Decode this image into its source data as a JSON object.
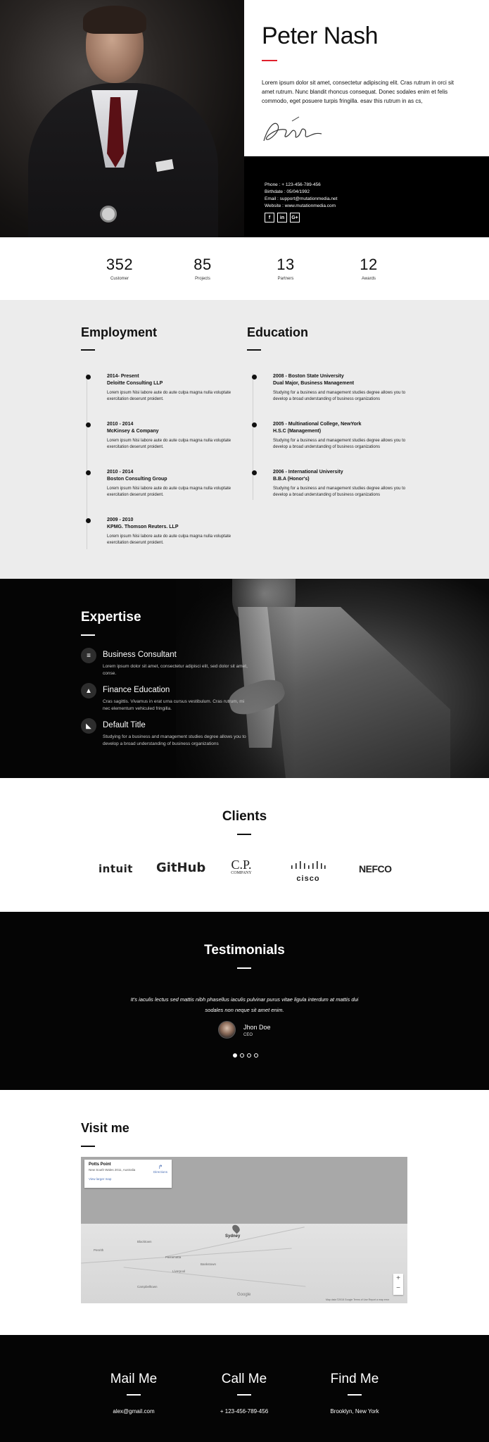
{
  "hero": {
    "name": "Peter Nash",
    "bio": "Lorem ipsum dolor sit amet, consectetur adipiscing elit. Cras rutrum in orci sit amet rutrum. Nunc blandit rhoncus consequat. Donec sodales enim et felis commodo, eget posuere turpis fringilla. esav this rutrum in as cs,",
    "accent_color": "#e0202c",
    "contact": {
      "phone": "Phone : + 123-456-789-456",
      "birthdate": "Birthdate : 05/04/1992",
      "email": "Email : support@mutationmedia.net",
      "website": "Website : www.mutationmedia.com"
    },
    "socials": [
      {
        "icon": "facebook-icon",
        "glyph": "f"
      },
      {
        "icon": "linkedin-icon",
        "glyph": "in"
      },
      {
        "icon": "google-plus-icon",
        "glyph": "G+"
      }
    ]
  },
  "stats": [
    {
      "value": "352",
      "label": "Customer"
    },
    {
      "value": "85",
      "label": "Projects"
    },
    {
      "value": "13",
      "label": "Partners"
    },
    {
      "value": "12",
      "label": "Awards"
    }
  ],
  "employment": {
    "title": "Employment",
    "items": [
      {
        "date": "2014- Present",
        "org": "Deloitte Consulting LLP",
        "desc": "Lorem ipsum Nisi labore aute do aute culpa magna nulla voluptate exercitation deserunt proident."
      },
      {
        "date": "2010 - 2014",
        "org": "McKinsey & Company",
        "desc": "Lorem ipsum Nisi labore aute do aute culpa magna nulla voluptate exercitation deserunt proident."
      },
      {
        "date": "2010 - 2014",
        "org": "Boston Consulting Group",
        "desc": "Lorem ipsum Nisi labore aute do aute culpa magna nulla voluptate exercitation deserunt proident."
      },
      {
        "date": "2009 - 2010",
        "org": "KPMG. Thomson Reuters. LLP",
        "desc": "Lorem ipsum Nisi labore aute do aute culpa magna nulla voluptate exercitation deserunt proident."
      }
    ]
  },
  "education": {
    "title": "Education",
    "items": [
      {
        "date": "2008 - Boston State University",
        "org": "Dual Major, Business Management",
        "desc": "Studying for a business and management studies degree allows you to develop a broad understanding of business organizations"
      },
      {
        "date": "2005 - Multinational College, NewYork",
        "org": "H.S.C (Management)",
        "desc": "Studying for a business and management studies degree allows you to develop a broad understanding of business organizations"
      },
      {
        "date": "2006 - International University",
        "org": "B.B.A (Honor's)",
        "desc": "Studying for a business and management studies degree allows you to develop a broad understanding of business organizations"
      }
    ]
  },
  "expertise": {
    "title": "Expertise",
    "items": [
      {
        "icon": "database-icon",
        "glyph": "≡",
        "name": "Business Consultant",
        "desc": "Lorem ipsum dolor sit amet, consectetur adipisci elit, sed dolor sit amet, conse."
      },
      {
        "icon": "graduation-cap-icon",
        "glyph": "▲",
        "name": "Finance Education",
        "desc": "Cras sagittis. Vivamus in erat urna cursus vestibulum. Cras rutrum, mi nec elementum vehiculed fringilla."
      },
      {
        "icon": "area-chart-icon",
        "glyph": "◣",
        "name": "Default Title",
        "desc": "Studying for a business and management studies degree allows you to develop a broad understanding of business organizations"
      }
    ]
  },
  "clients": {
    "title": "Clients",
    "logos": [
      "intuit",
      "GitHub",
      "C.P.",
      "cisco",
      "NEFCO"
    ],
    "cp_sub": "COMPANY"
  },
  "testimonials": {
    "title": "Testimonials",
    "quote": "It's iaculis lectus sed mattis nibh phasellus iaculis pulvinar purus vitae ligula interdum at mattis dui sodales non neque sit amet enim.",
    "name": "Jhon Doe",
    "role": "CEO",
    "dots": 4,
    "active_dot": 0
  },
  "visit": {
    "title": "Visit me",
    "map": {
      "place": "Potts Point",
      "address": "New South Wales 2011, Australia",
      "larger_map": "View larger map",
      "directions": "Directions",
      "city": "Sydney",
      "google": "Google",
      "footer": "Map data ©2018 Google   Terms of Use   Report a map error",
      "labels": [
        "Penrith",
        "Parramatta",
        "Blacktown",
        "Campbelltown",
        "Liverpool",
        "Bankstown"
      ],
      "zoom_in": "+",
      "zoom_out": "−"
    }
  },
  "contact": [
    {
      "title": "Mail Me",
      "value": "alex@gmail.com"
    },
    {
      "title": "Call Me",
      "value": "+ 123-456-789-456"
    },
    {
      "title": "Find Me",
      "value": "Brooklyn, New York"
    }
  ]
}
